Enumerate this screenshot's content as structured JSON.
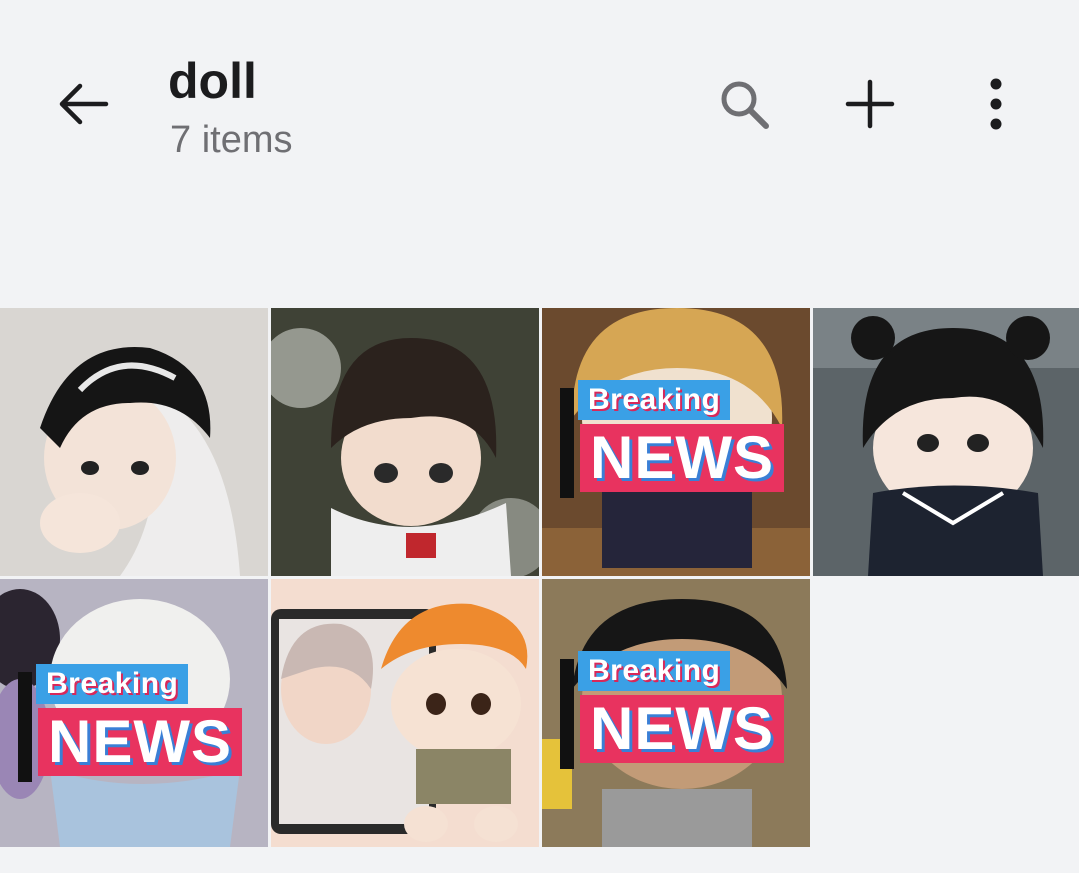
{
  "header": {
    "title": "doll",
    "subtitle": "7 items",
    "icons": [
      "arrow-left-icon",
      "search-icon",
      "plus-icon",
      "more-vert-icon"
    ]
  },
  "gallery": {
    "items": [
      {
        "name": "doll-photo-1",
        "banner": null,
        "bg": "#d9d6d2"
      },
      {
        "name": "doll-photo-2",
        "banner": null,
        "bg": "#3f4236"
      },
      {
        "name": "doll-photo-3",
        "banner": {
          "top": "Breaking",
          "main": "NEWS"
        },
        "bg": "#b28a5a"
      },
      {
        "name": "doll-photo-4",
        "banner": null,
        "bg": "#5c6468"
      },
      {
        "name": "doll-photo-5",
        "banner": {
          "top": "Breaking",
          "main": "NEWS"
        },
        "bg": "#b7b4c2"
      },
      {
        "name": "doll-photo-6",
        "banner": null,
        "bg": "#f4ddd0"
      },
      {
        "name": "doll-photo-7",
        "banner": {
          "top": "Breaking",
          "main": "NEWS"
        },
        "bg": "#8c7a5a"
      }
    ]
  },
  "colors": {
    "background": "#f2f3f5",
    "banner_blue": "#3aa0e6",
    "banner_red": "#e8335f"
  }
}
